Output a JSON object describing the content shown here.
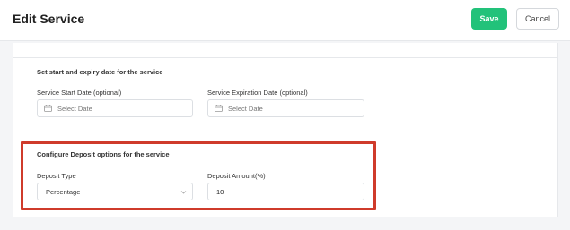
{
  "header": {
    "title": "Edit Service",
    "save_label": "Save",
    "cancel_label": "Cancel"
  },
  "dates_section": {
    "title": "Set start and expiry date for the service",
    "start_label": "Service Start Date (optional)",
    "start_placeholder": "Select Date",
    "expiry_label": "Service Expiration Date (optional)",
    "expiry_placeholder": "Select Date"
  },
  "deposit_section": {
    "title": "Configure Deposit options for the service",
    "type_label": "Deposit Type",
    "type_value": "Percentage",
    "amount_label": "Deposit Amount(%)",
    "amount_value": "10"
  },
  "colors": {
    "accent": "#22c27a",
    "highlight": "#cf3b2b"
  },
  "icons": {
    "date_field": "calendar-icon",
    "select": "chevron-down-icon"
  }
}
